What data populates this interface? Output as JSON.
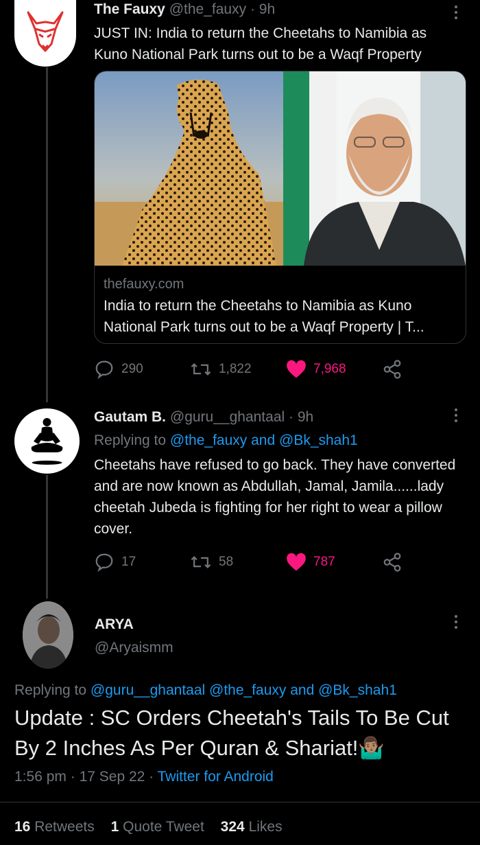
{
  "tweet1": {
    "name": "The Fauxy",
    "handle": "@the_fauxy",
    "time": "· 9h",
    "text": "JUST IN: India to return the Cheetahs to Namibia as Kuno National Park turns out to be a Waqf Property",
    "card": {
      "domain": "thefauxy.com",
      "title": "India to return the Cheetahs to Namibia as Kuno National Park turns out to be a Waqf Property | T..."
    },
    "replies": "290",
    "retweets": "1,822",
    "likes": "7,968"
  },
  "tweet2": {
    "name": "Gautam B.",
    "handle": "@guru__ghantaal",
    "time": "· 9h",
    "replying_prefix": "Replying to ",
    "replying_to": "@the_fauxy and @Bk_shah1",
    "text": "Cheetahs have refused to go back. They have converted and are now known as Abdullah, Jamal, Jamila......lady cheetah Jubeda is fighting for her right to wear a pillow cover.",
    "replies": "17",
    "retweets": "58",
    "likes": "787"
  },
  "tweet3": {
    "name": "ARYA",
    "handle": "@Aryaismm",
    "replying_prefix": "Replying to ",
    "replying_to": "@guru__ghantaal @the_fauxy and @Bk_shah1",
    "text": "Update : SC Orders Cheetah's Tails To Be Cut By 2 Inches As Per Quran & Shariat!",
    "emoji": "🤷🏽‍♂️",
    "time": "1:56 pm",
    "date": "17 Sep 22",
    "source": "Twitter for Android",
    "retweets_count": "16",
    "retweets_label": "Retweets",
    "quotes_count": "1",
    "quotes_label": "Quote Tweet",
    "likes_count": "324",
    "likes_label": "Likes"
  },
  "colors": {
    "background": "#000000",
    "text": "#e7e9ea",
    "muted": "#71767b",
    "link": "#1d9bf0",
    "like": "#f91880"
  }
}
